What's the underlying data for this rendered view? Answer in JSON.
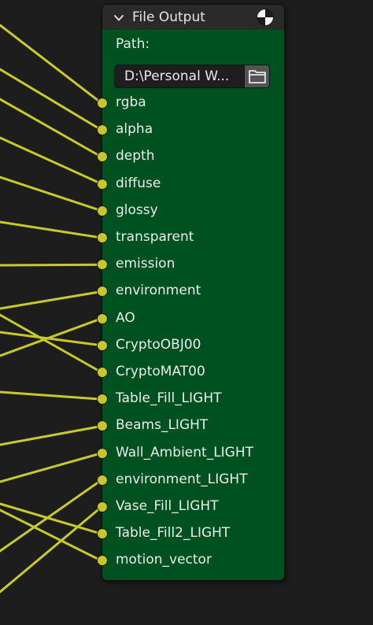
{
  "node": {
    "title": "File Output",
    "path_label": "Path:",
    "path_value": "D:\\Personal W...",
    "inputs": [
      "rgba",
      "alpha",
      "depth",
      "diffuse",
      "glossy",
      "transparent",
      "emission",
      "environment",
      "AO",
      "CryptoOBJ00",
      "CryptoMAT00",
      "Table_Fill_LIGHT",
      "Beams_LIGHT",
      "Wall_Ambient_LIGHT",
      "environment_LIGHT",
      "Vase_Fill_LIGHT",
      "Table_Fill2_LIGHT",
      "motion_vector"
    ]
  },
  "icons": {
    "collapse": "chevron-down-icon",
    "preview": "preview-sphere-icon",
    "folder": "folder-icon"
  },
  "colors": {
    "node_body": "#005120",
    "node_header": "#2a2a2a",
    "socket": "#c7c729",
    "wire": "#c9c92a",
    "background": "#1d1d1d"
  }
}
